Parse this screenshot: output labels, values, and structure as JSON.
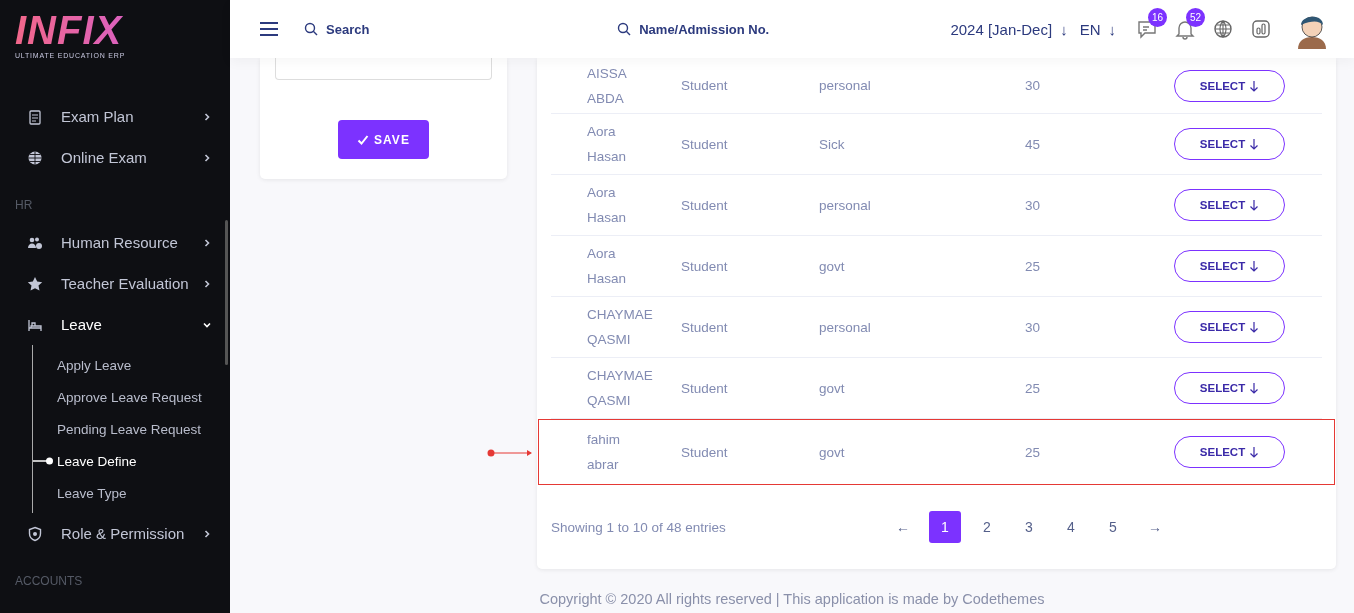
{
  "logo": {
    "wordmark": "INFIX",
    "tagline": "ULTIMATE EDUCATION ERP"
  },
  "sidebar": {
    "sections": [
      {
        "items": [
          {
            "label": "Exam Plan",
            "expanded": false
          },
          {
            "label": "Online Exam",
            "expanded": false
          }
        ]
      },
      {
        "heading": "HR",
        "items": [
          {
            "label": "Human Resource",
            "expanded": false
          },
          {
            "label": "Teacher Evaluation",
            "expanded": false
          },
          {
            "label": "Leave",
            "expanded": true,
            "children": [
              {
                "label": "Apply Leave",
                "selected": false
              },
              {
                "label": "Approve Leave Request",
                "selected": false
              },
              {
                "label": "Pending Leave Request",
                "selected": false
              },
              {
                "label": "Leave Define",
                "selected": true
              },
              {
                "label": "Leave Type",
                "selected": false
              }
            ]
          },
          {
            "label": "Role & Permission",
            "expanded": false
          }
        ]
      },
      {
        "heading": "ACCOUNTS"
      }
    ]
  },
  "header": {
    "search": {
      "placeholder": "Search"
    },
    "student_search": {
      "placeholder": "Name/Admission No."
    },
    "session": "2024 [Jan-Dec]",
    "session_arrow": "↓",
    "language": "EN",
    "language_arrow": "↓",
    "messages_badge": "16",
    "notifications_badge": "52"
  },
  "form": {
    "save_button": "SAVE"
  },
  "table": {
    "rows": [
      {
        "name": "AISSA ABDA",
        "role": "Student",
        "leave_type": "personal",
        "days": "30",
        "action": "SELECT",
        "highlighted": false
      },
      {
        "name": "Aora Hasan",
        "role": "Student",
        "leave_type": "Sick",
        "days": "45",
        "action": "SELECT",
        "highlighted": false
      },
      {
        "name": "Aora Hasan",
        "role": "Student",
        "leave_type": "personal",
        "days": "30",
        "action": "SELECT",
        "highlighted": false
      },
      {
        "name": "Aora Hasan",
        "role": "Student",
        "leave_type": "govt",
        "days": "25",
        "action": "SELECT",
        "highlighted": false
      },
      {
        "name": "CHAYMAE QASMI",
        "role": "Student",
        "leave_type": "personal",
        "days": "30",
        "action": "SELECT",
        "highlighted": false
      },
      {
        "name": "CHAYMAE QASMI",
        "role": "Student",
        "leave_type": "govt",
        "days": "25",
        "action": "SELECT",
        "highlighted": false
      },
      {
        "name": "fahim abrar",
        "role": "Student",
        "leave_type": "govt",
        "days": "25",
        "action": "SELECT",
        "highlighted": true
      }
    ],
    "summary": "Showing 1 to 10 of 48 entries",
    "pagination": {
      "prev": "←",
      "next": "→",
      "pages": [
        {
          "label": "1",
          "selected": true
        },
        {
          "label": "2",
          "selected": false
        },
        {
          "label": "3",
          "selected": false
        },
        {
          "label": "4",
          "selected": false
        },
        {
          "label": "5",
          "selected": false
        }
      ]
    }
  },
  "footer": "Copyright © 2020 All rights reserved | This application is made by Codethemes"
}
